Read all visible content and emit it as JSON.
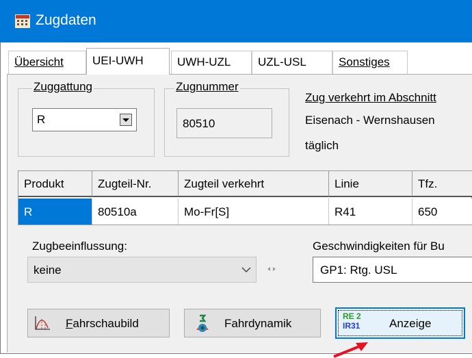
{
  "window": {
    "title": "Zugdaten",
    "icon": "train-schedule-icon"
  },
  "tabs": [
    {
      "label": "Übersicht",
      "active": false
    },
    {
      "label": "UEI-UWH",
      "active": true
    },
    {
      "label": "UWH-UZL",
      "active": false
    },
    {
      "label": "UZL-USL",
      "active": false
    },
    {
      "label": "Sonstiges",
      "active": false
    }
  ],
  "zuggattung": {
    "label": "Zuggattung",
    "value": "R"
  },
  "zugnummer": {
    "label": "Zugnummer",
    "value": "80510"
  },
  "abschnitt": {
    "label": "Zug verkehrt im Abschnitt",
    "route": "Eisenach - Wernshausen",
    "frequency": "täglich"
  },
  "table": {
    "columns": [
      "Produkt",
      "Zugteil-Nr.",
      "Zugteil verkehrt",
      "Linie",
      "Tfz."
    ],
    "rows": [
      [
        "R",
        "80510a",
        "Mo-Fr[S]",
        "R41",
        "650"
      ]
    ]
  },
  "zugbeeinflussung": {
    "label": "Zugbeeinflussung:",
    "value": "keine"
  },
  "geschwindigkeiten": {
    "label": "Geschwindigkeiten für Bu",
    "value": "GP1: Rtg. USL"
  },
  "buttons": {
    "fahrschaubild": "Fahrschaubild",
    "fahrdynamik": "Fahrdynamik",
    "anzeige": "Anzeige",
    "anzeige_icon_top": "RE 2",
    "anzeige_icon_bottom": "IR31"
  },
  "colors": {
    "titlebar": "#0078d7",
    "selection": "#0078d7",
    "pointer": "#e81123"
  }
}
